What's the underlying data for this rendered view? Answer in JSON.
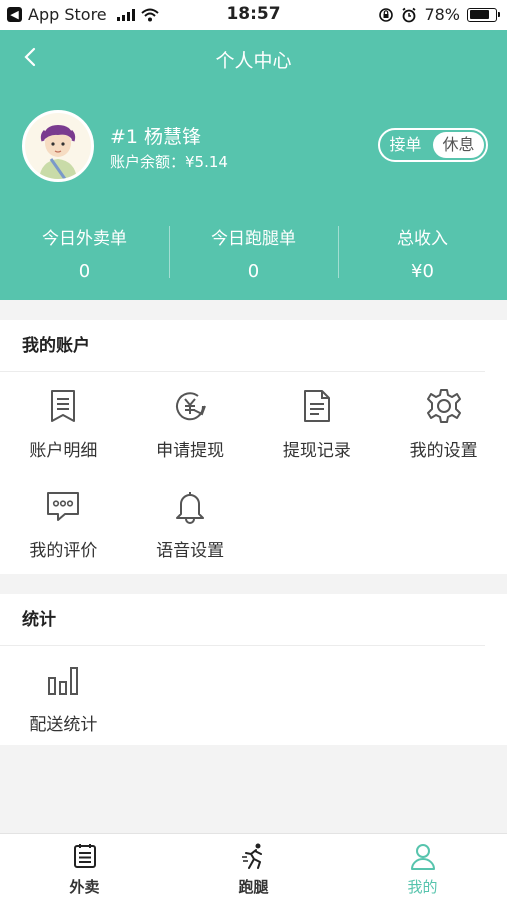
{
  "status_bar": {
    "back_app": "App Store",
    "time": "18:57",
    "battery": "78%",
    "battery_level": 0.78
  },
  "header": {
    "title": "个人中心",
    "user_name": "#1 杨慧锋",
    "balance": "账户余额：¥5.14",
    "toggle": {
      "on_label": "接单",
      "off_label": "休息",
      "selected": "休息"
    },
    "stats": [
      {
        "label": "今日外卖单",
        "value": "0"
      },
      {
        "label": "今日跑腿单",
        "value": "0"
      },
      {
        "label": "总收入",
        "value": "¥0"
      }
    ]
  },
  "account": {
    "title": "我的账户",
    "items": [
      {
        "label": "账户明细",
        "icon": "bookmark-list-icon"
      },
      {
        "label": "申请提现",
        "icon": "yuan-cycle-icon"
      },
      {
        "label": "提现记录",
        "icon": "document-icon"
      },
      {
        "label": "我的设置",
        "icon": "gear-icon"
      },
      {
        "label": "我的评价",
        "icon": "chat-bubble-icon"
      },
      {
        "label": "语音设置",
        "icon": "bell-icon"
      }
    ]
  },
  "statistics": {
    "title": "统计",
    "items": [
      {
        "label": "配送统计",
        "icon": "bar-chart-icon"
      }
    ]
  },
  "tabbar": {
    "items": [
      {
        "label": "外卖",
        "icon": "list-icon"
      },
      {
        "label": "跑腿",
        "icon": "runner-icon"
      },
      {
        "label": "我的",
        "icon": "person-icon"
      }
    ],
    "active": "我的"
  },
  "colors": {
    "accent": "#57c4ad",
    "icon": "#555555"
  }
}
